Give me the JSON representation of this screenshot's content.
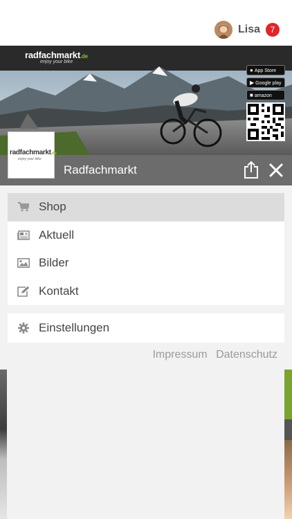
{
  "user": {
    "name": "Lisa",
    "notifications": "7"
  },
  "banner": {
    "brand": "radfachmarkt",
    "brand_tld": ".de",
    "tagline": "enjoy your bike",
    "badges": [
      {
        "icon": "apple-icon",
        "label": "App Store"
      },
      {
        "icon": "play-icon",
        "label": "Google play"
      },
      {
        "icon": "amazon-icon",
        "label": "amazon"
      }
    ]
  },
  "header": {
    "title": "Radfachmarkt"
  },
  "menu": {
    "items": [
      {
        "label": "Shop",
        "icon": "cart-icon",
        "active": true
      },
      {
        "label": "Aktuell",
        "icon": "newspaper-icon",
        "active": false
      },
      {
        "label": "Bilder",
        "icon": "image-icon",
        "active": false
      },
      {
        "label": "Kontakt",
        "icon": "edit-icon",
        "active": false
      }
    ],
    "settings": {
      "label": "Einstellungen",
      "icon": "gear-icon"
    }
  },
  "footer": {
    "impressum": "Impressum",
    "datenschutz": "Datenschutz"
  },
  "colors": {
    "header": "#6c6c6c",
    "active": "#dcdcdc",
    "badge": "#e0252b",
    "brand_green": "#8fbe2e"
  }
}
